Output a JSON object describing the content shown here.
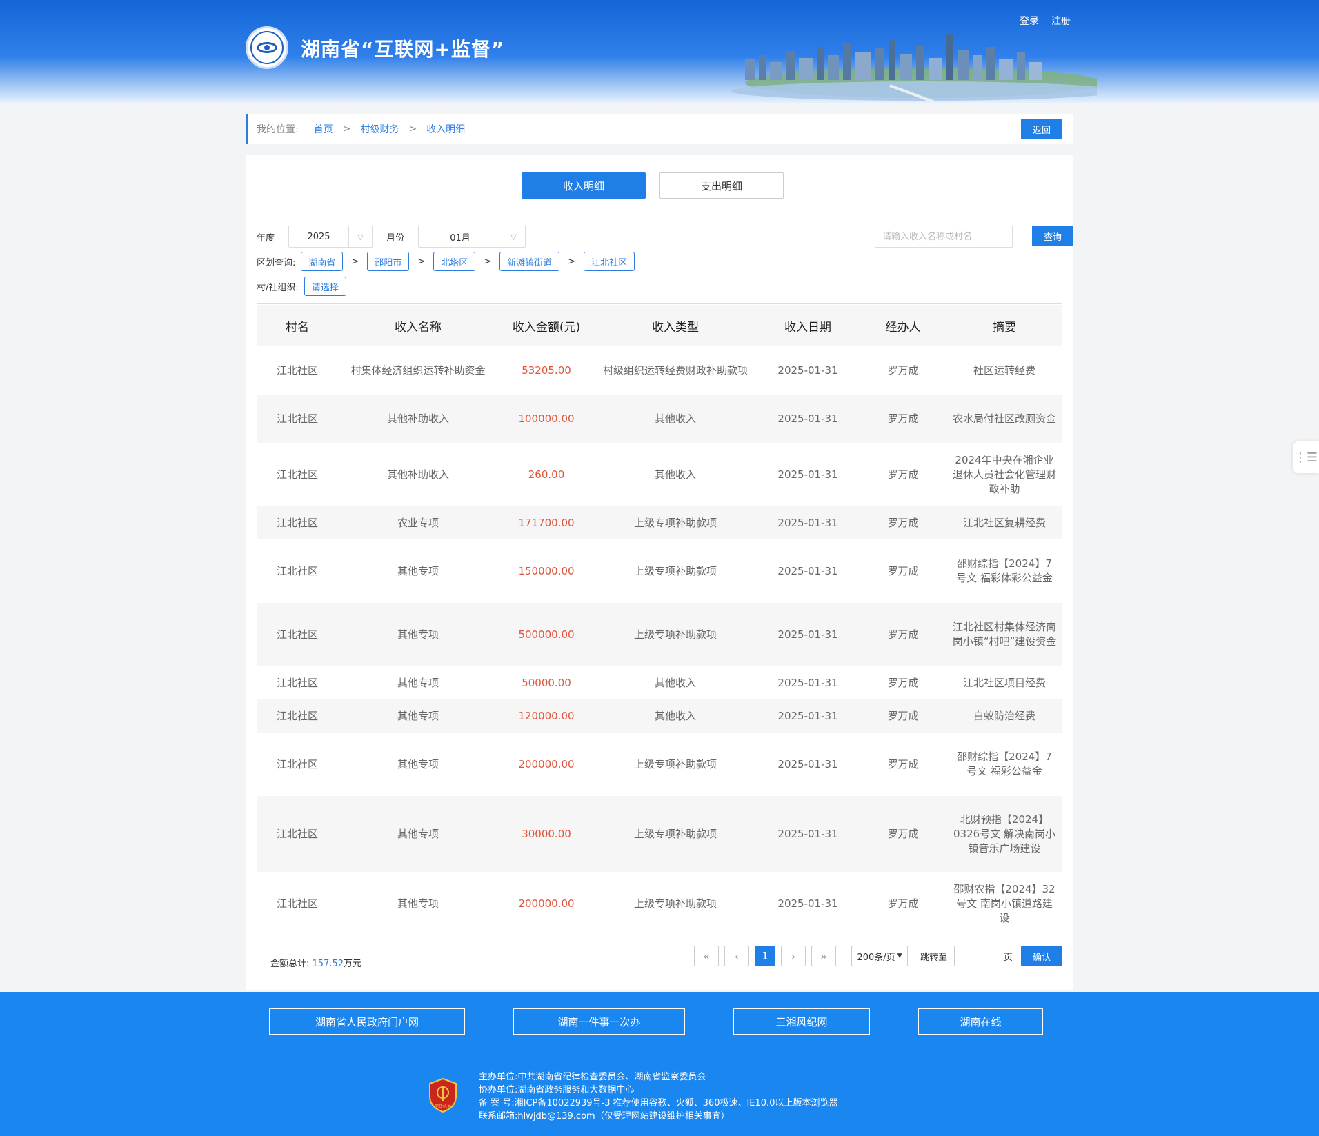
{
  "header": {
    "site_title": "湖南省“互联网+监督”",
    "login": "登录",
    "register": "注册"
  },
  "breadcrumb": {
    "lead": "我的位置:",
    "items": [
      "首页",
      "村级财务",
      "收入明细"
    ],
    "separator": ">",
    "back": "返回"
  },
  "tabs": [
    {
      "label": "收入明细",
      "active": true
    },
    {
      "label": "支出明细",
      "active": false
    }
  ],
  "filters": {
    "year_label": "年度",
    "year_value": "2025",
    "month_label": "月份",
    "month_value": "01月",
    "search_placeholder": "请输入收入名称或村名",
    "query_button": "查询",
    "region_label": "区划查询:",
    "region_path": [
      "湖南省",
      "邵阳市",
      "北塔区",
      "新滩镇街道",
      "江北社区"
    ],
    "village_label": "村/社组织:",
    "village_value": "请选择"
  },
  "table": {
    "headers": [
      "村名",
      "收入名称",
      "收入金额(元)",
      "收入类型",
      "收入日期",
      "经办人",
      "摘要"
    ],
    "rows": [
      {
        "village": "江北社区",
        "name": "村集体经济组织运转补助资金",
        "amount": "53205.00",
        "type": "村级组织运转经费财政补助款项",
        "date": "2025-01-31",
        "handler": "罗万成",
        "summary": "社区运转经费"
      },
      {
        "village": "江北社区",
        "name": "其他补助收入",
        "amount": "100000.00",
        "type": "其他收入",
        "date": "2025-01-31",
        "handler": "罗万成",
        "summary": "农水局付社区改厕资金"
      },
      {
        "village": "江北社区",
        "name": "其他补助收入",
        "amount": "260.00",
        "type": "其他收入",
        "date": "2025-01-31",
        "handler": "罗万成",
        "summary": "2024年中央在湘企业退休人员社会化管理财政补助"
      },
      {
        "village": "江北社区",
        "name": "农业专项",
        "amount": "171700.00",
        "type": "上级专项补助款项",
        "date": "2025-01-31",
        "handler": "罗万成",
        "summary": "江北社区复耕经费"
      },
      {
        "village": "江北社区",
        "name": "其他专项",
        "amount": "150000.00",
        "type": "上级专项补助款项",
        "date": "2025-01-31",
        "handler": "罗万成",
        "summary": "邵财综指【2024】7号文 福彩体彩公益金"
      },
      {
        "village": "江北社区",
        "name": "其他专项",
        "amount": "500000.00",
        "type": "上级专项补助款项",
        "date": "2025-01-31",
        "handler": "罗万成",
        "summary": "江北社区村集体经济南岗小镇“村吧”建设资金"
      },
      {
        "village": "江北社区",
        "name": "其他专项",
        "amount": "50000.00",
        "type": "其他收入",
        "date": "2025-01-31",
        "handler": "罗万成",
        "summary": "江北社区项目经费"
      },
      {
        "village": "江北社区",
        "name": "其他专项",
        "amount": "120000.00",
        "type": "其他收入",
        "date": "2025-01-31",
        "handler": "罗万成",
        "summary": "白蚁防治经费"
      },
      {
        "village": "江北社区",
        "name": "其他专项",
        "amount": "200000.00",
        "type": "上级专项补助款项",
        "date": "2025-01-31",
        "handler": "罗万成",
        "summary": "邵财综指【2024】7号文 福彩公益金"
      },
      {
        "village": "江北社区",
        "name": "其他专项",
        "amount": "30000.00",
        "type": "上级专项补助款项",
        "date": "2025-01-31",
        "handler": "罗万成",
        "summary": "北财预指【2024】0326号文 解决南岗小镇音乐广场建设"
      },
      {
        "village": "江北社区",
        "name": "其他专项",
        "amount": "200000.00",
        "type": "上级专项补助款项",
        "date": "2025-01-31",
        "handler": "罗万成",
        "summary": "邵财农指【2024】32号文 南岗小镇道路建设"
      }
    ]
  },
  "summary": {
    "label": "金额总计:",
    "value": "157.52",
    "unit": "万元"
  },
  "pagination": {
    "first": "«",
    "prev": "‹",
    "current": "1",
    "next": "›",
    "last": "»",
    "page_size": "200条/页",
    "jump_label": "跳转至",
    "page_unit": "页",
    "confirm": "确认"
  },
  "footer": {
    "links": [
      "湖南省人民政府门户网",
      "湖南一件事一次办",
      "三湘风纪网",
      "湖南在线"
    ],
    "badge_text": "党政机关",
    "info": [
      "主办单位:中共湖南省纪律检查委员会、湖南省监察委员会",
      "协办单位:湖南省政务服务和大数据中心",
      "备  案  号:湘ICP备10022939号-3   推荐使用谷歌、火狐、360极速、IE10.0以上版本浏览器",
      "联系邮箱:hlwjdb@139.com（仅受理网站建设维护相关事宜）"
    ]
  },
  "colors": {
    "primary": "#1f7fe6",
    "amount": "#e0553a",
    "footer_bg": "#1a86f0"
  }
}
